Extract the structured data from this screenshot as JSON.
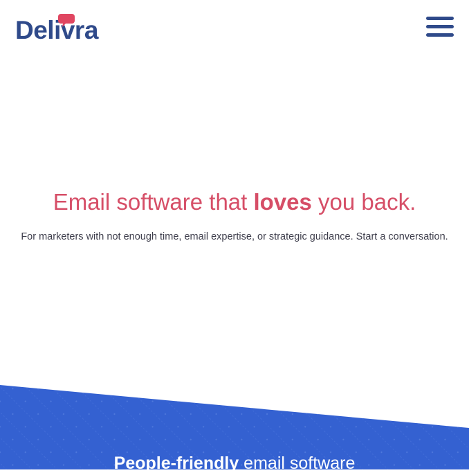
{
  "header": {
    "logo_text": "Delivra",
    "menu_button": "menu"
  },
  "hero": {
    "headline_before": "Email software that ",
    "headline_emphasis": "loves",
    "headline_after": " you back.",
    "subtext": "For marketers with not enough time, email expertise, or strategic guidance. Start a conversation."
  },
  "band": {
    "title_emphasis": "People-friendly",
    "title_rest": " email software"
  },
  "colors": {
    "brand_navy": "#2f4a8a",
    "accent_pink": "#d64e67",
    "band_blue": "#3461d1"
  },
  "icons": {
    "logo_bubble": "speech-bubble-icon",
    "menu": "hamburger-menu-icon"
  }
}
